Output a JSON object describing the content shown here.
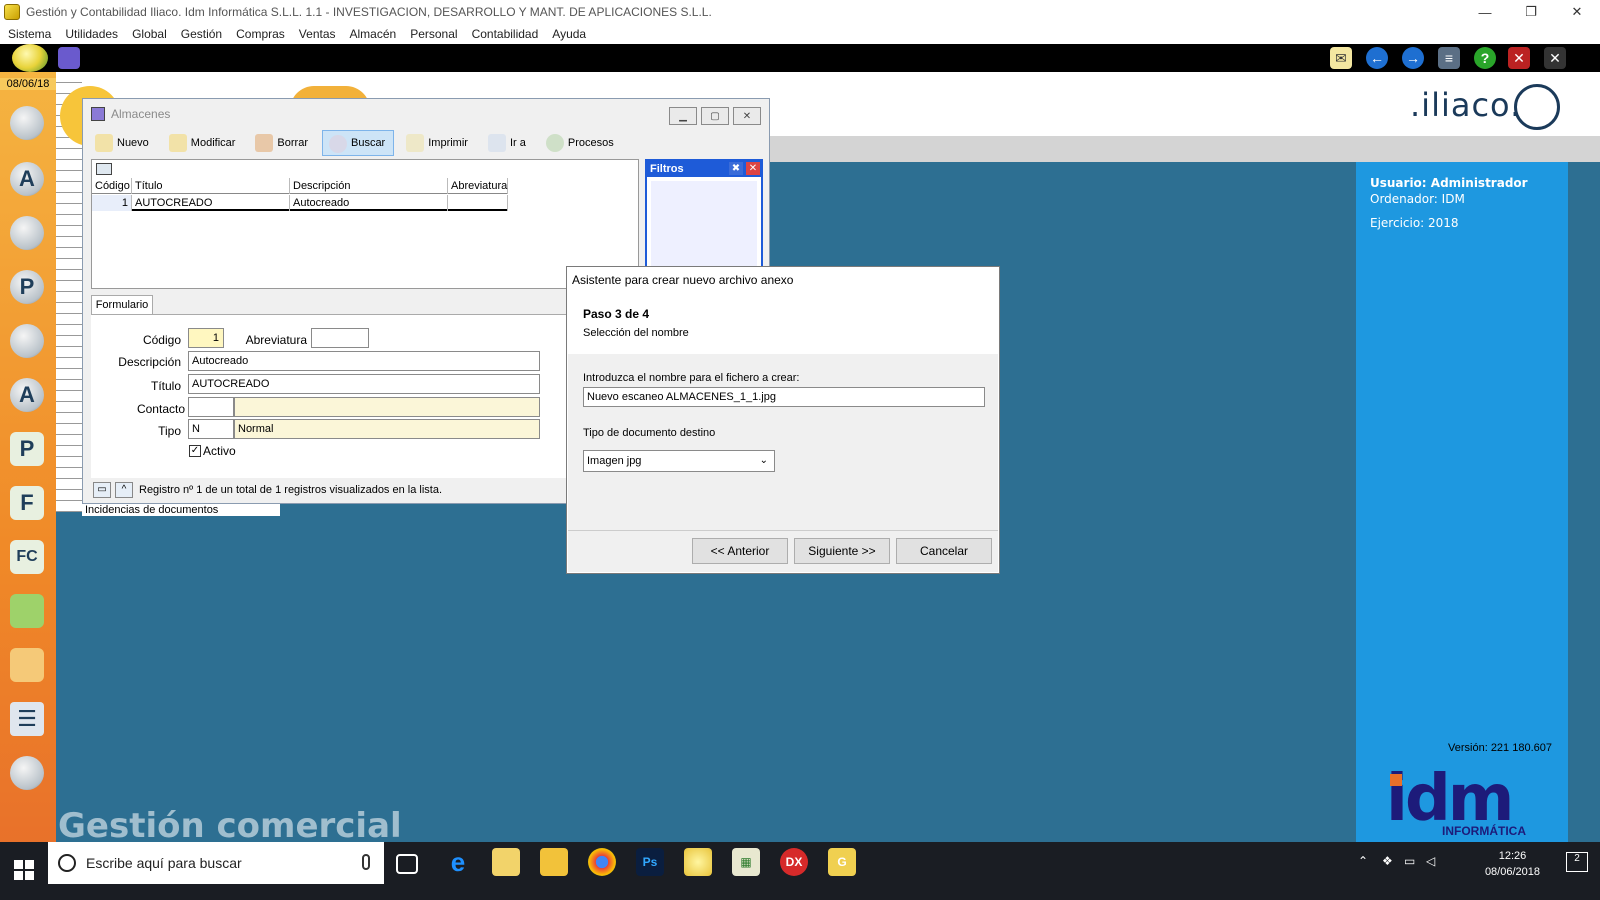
{
  "window": {
    "title": "Gestión y Contabilidad Iliaco. Idm Informática S.L.L. 1.1 - INVESTIGACION, DESARROLLO Y MANT. DE APLICACIONES S.L.L.",
    "min": "—",
    "max": "❐",
    "close": "✕"
  },
  "menu": [
    "Sistema",
    "Utilidades",
    "Global",
    "Gestión",
    "Compras",
    "Ventas",
    "Almacén",
    "Personal",
    "Contabilidad",
    "Ayuda"
  ],
  "sidebar": {
    "date": "08/06/18",
    "icons": [
      "users-icon",
      "text-a-icon",
      "user-icon",
      "user-p-icon",
      "users-group-icon",
      "user-a-icon",
      "letter-p-icon",
      "letter-f-icon",
      "letter-fc-icon",
      "bag-icon",
      "bag-orange-icon",
      "ledger-icon",
      "magic-cd-icon"
    ]
  },
  "brand": {
    "logo": ".iliaco."
  },
  "info": {
    "user": "Usuario: Administrador",
    "computer": "Ordenador: IDM",
    "year": "Ejercicio: 2018",
    "version": "Versión: 221 180.607",
    "idm_big": "idm",
    "idm_small": "INFORMÁTICA"
  },
  "background_text": "Gestión comercial",
  "almacenes": {
    "title": "Almacenes",
    "toolbar": [
      "Nuevo",
      "Modificar",
      "Borrar",
      "Buscar",
      "Imprimir",
      "Ir a",
      "Procesos"
    ],
    "grid": {
      "headers": [
        "Código",
        "Título",
        "Descripción",
        "Abreviatura"
      ],
      "row": [
        "1",
        "AUTOCREADO",
        "Autocreado",
        ""
      ]
    },
    "filtros": "Filtros",
    "form_tab": "Formulario",
    "labels": {
      "codigo": "Código",
      "abreviatura": "Abreviatura",
      "descripcion": "Descripción",
      "titulo": "Título",
      "contacto": "Contacto",
      "tipo": "Tipo",
      "activo": "Activo"
    },
    "values": {
      "codigo": "1",
      "abreviatura": "",
      "descripcion": "Autocreado",
      "titulo": "AUTOCREADO",
      "contacto": "",
      "contacto_name": "",
      "tipo": "N",
      "tipo_name": "Normal",
      "activo": "✓"
    },
    "status": "Registro nº 1 de un total de 1 registros visualizados en la lista.",
    "incidencias": "Incidencias de documentos"
  },
  "wizard": {
    "title": "Asistente para crear nuevo archivo anexo",
    "step": "Paso 3 de 4",
    "step_desc": "Selección del nombre",
    "file_label": "Introduzca el nombre para el fichero a crear:",
    "file_value": "Nuevo escaneo ALMACENES_1_1.jpg",
    "type_label": "Tipo de documento destino",
    "type_value": "Imagen jpg",
    "prev": "<< Anterior",
    "next": "Siguiente >>",
    "cancel": "Cancelar"
  },
  "taskbar": {
    "search_placeholder": "Escribe aquí para buscar",
    "time": "12:26",
    "date": "08/06/2018",
    "notifications": "2"
  },
  "colors": {
    "accent": "#1e98e0",
    "sidebar": "#f08a28",
    "desktop": "#2d6f92"
  }
}
